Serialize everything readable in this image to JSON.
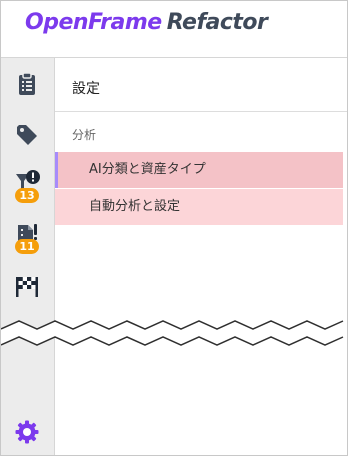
{
  "header": {
    "brand_part1": "OpenFrame",
    "brand_part2": "Refactor"
  },
  "rail": {
    "items": [
      {
        "icon": "clipboard-list-icon"
      },
      {
        "icon": "tag-icon"
      },
      {
        "icon": "funnel-alert-icon",
        "badge": "13"
      },
      {
        "icon": "document-alert-icon",
        "badge": "11"
      },
      {
        "icon": "checkered-flag-icon"
      }
    ],
    "settings_icon": "gear-icon"
  },
  "main": {
    "title": "設定",
    "section": "分析",
    "items": [
      {
        "label": "AI分類と資産タイプ",
        "selected": true
      },
      {
        "label": "自動分析と設定",
        "selected": false
      }
    ]
  },
  "colors": {
    "brand": "#7c3aed",
    "badge": "#f59e0b",
    "selected_bg": "#f4c2c7",
    "item_bg": "#fcd5d8"
  }
}
